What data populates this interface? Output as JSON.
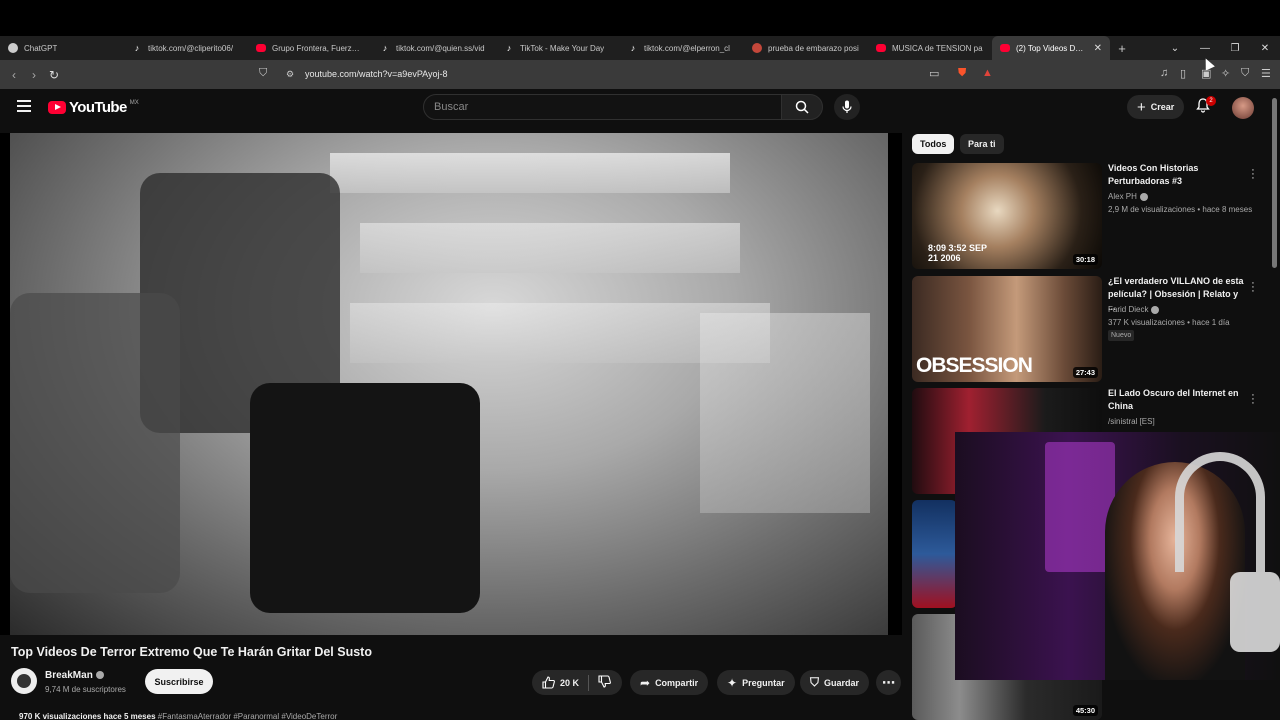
{
  "browser": {
    "tabs": [
      {
        "label": "ChatGPT",
        "favicon": "chatgpt-icon",
        "active": false
      },
      {
        "label": "tiktok.com/@cliperito06/",
        "favicon": "tiktok-icon",
        "active": false
      },
      {
        "label": "Grupo Frontera, Fuerza R",
        "favicon": "youtube-icon",
        "active": false
      },
      {
        "label": "tiktok.com/@quien.ss/vid",
        "favicon": "tiktok-icon",
        "active": false
      },
      {
        "label": "TikTok - Make Your Day",
        "favicon": "tiktok-icon",
        "active": false
      },
      {
        "label": "tiktok.com/@elperron_cl",
        "favicon": "tiktok-icon",
        "active": false
      },
      {
        "label": "prueba de embarazo posi",
        "favicon": "pr-icon",
        "active": false
      },
      {
        "label": "MUSICA de TENSION pa",
        "favicon": "youtube-icon",
        "active": false
      },
      {
        "label": "(2) Top Videos De Te",
        "favicon": "youtube-icon",
        "active": true
      }
    ],
    "new_tab": "+",
    "url": "youtube.com/watch?v=a9evPAyoj-8"
  },
  "youtube": {
    "logo_text": "YouTube",
    "country": "MX",
    "search_placeholder": "Buscar",
    "create_label": "Crear",
    "notif_count": "2"
  },
  "video": {
    "title": "Top Videos De Terror Extremo Que Te Harán Gritar Del Susto",
    "channel": "BreakMan",
    "subscribers": "9,74 M de suscriptores",
    "subscribe_label": "Suscribirse",
    "likes": "20 K",
    "share_label": "Compartir",
    "ask_label": "Preguntar",
    "save_label": "Guardar",
    "views_line": "970 K visualizaciones  hace 5 meses",
    "tags": "#FantasmaAterrador #Paranormal #VideoDeTerror"
  },
  "sidebar": {
    "chips": [
      "Todos",
      "Para ti"
    ],
    "items": [
      {
        "title": "Videos Con Historias Perturbadoras #3",
        "channel": "Alex PH",
        "meta": "2,9 M de visualizaciones • hace 8 meses",
        "duration": "30:18",
        "thumb_caption": "8:09 3:52 SEP 21 2006"
      },
      {
        "title": "¿El verdadero VILLANO de esta película? | Obsesión | Relato y ...",
        "channel": "Farid Dieck",
        "meta": "377 K visualizaciones • hace 1 día",
        "badge": "Nuevo",
        "duration": "27:43",
        "thumb_caption": "OBSESSION"
      },
      {
        "title": "El Lado Oscuro del Internet en China",
        "channel": "/sinistral [ES]",
        "meta": "",
        "duration": ""
      },
      {
        "duration": "45:30"
      }
    ]
  },
  "colors": {
    "accent": "#ff0033",
    "bg": "#0f0f0f",
    "chip": "#272727"
  }
}
